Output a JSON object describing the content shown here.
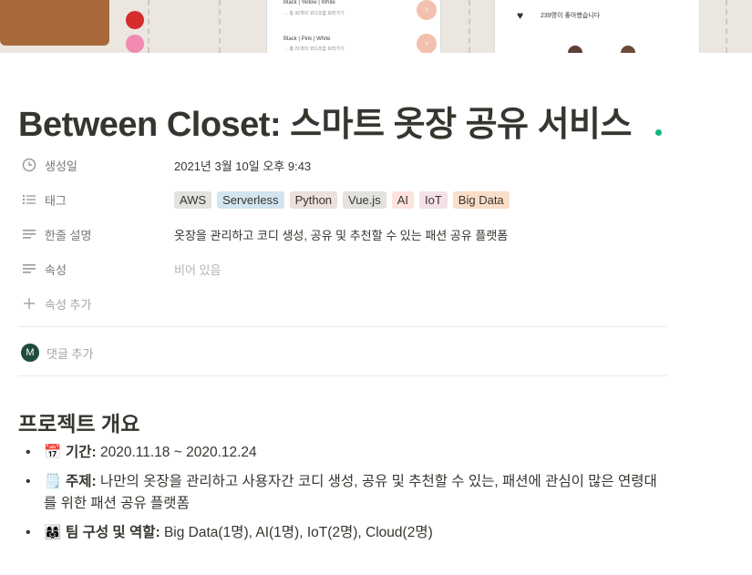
{
  "cover": {
    "rows": [
      {
        "label": "Black | Yellow | White",
        "sub": "→ 총 32개의 코디조합 보러가기"
      },
      {
        "label": "Black | Pink | White",
        "sub": "→ 총 21개의 코디조합 보러가기"
      }
    ],
    "likes_text": "239명이 좋아했습니다",
    "swatch_colors": [
      "#d62c2c",
      "#f08ab0"
    ]
  },
  "title": "Between Closet: 스마트 옷장 공유 서비스",
  "properties": {
    "created": {
      "label": "생성일",
      "value": "2021년 3월 10일 오후 9:43"
    },
    "tags": {
      "label": "태그",
      "items": [
        {
          "name": "AWS",
          "color": "#e3e2e0"
        },
        {
          "name": "Serverless",
          "color": "#d3e5ef"
        },
        {
          "name": "Python",
          "color": "#eee0da"
        },
        {
          "name": "Vue.js",
          "color": "#e3e2e0"
        },
        {
          "name": "AI",
          "color": "#ffe2dd"
        },
        {
          "name": "IoT",
          "color": "#f5e0e9"
        },
        {
          "name": "Big Data",
          "color": "#fadec9"
        }
      ]
    },
    "summary": {
      "label": "한줄 설명",
      "value": "옷장을 관리하고 코디 생성, 공유 및 추천할 수 있는 패션 공유 플랫폼"
    },
    "attribute": {
      "label": "속성",
      "value": "비어 있음"
    },
    "add_property": "속성 추가"
  },
  "comment": {
    "avatar_initial": "M",
    "placeholder": "댓글 추가"
  },
  "section": {
    "heading": "프로젝트 개요",
    "items": [
      {
        "emoji": "📅",
        "bold": "기간:",
        "text": " 2020.11.18 ~ 2020.12.24"
      },
      {
        "emoji": "🗒️",
        "bold": "주제:",
        "text": " 나만의 옷장을 관리하고 사용자간 코디 생성, 공유 및 추천할 수 있는, 패션에 관심이 많은 연령대를 위한 패션 공유 플랫폼"
      },
      {
        "emoji": "👩‍👩‍👧",
        "bold": "팀 구성 및 역할:",
        "text": " Big Data(1명), AI(1명), IoT(2명), Cloud(2명)"
      }
    ]
  }
}
